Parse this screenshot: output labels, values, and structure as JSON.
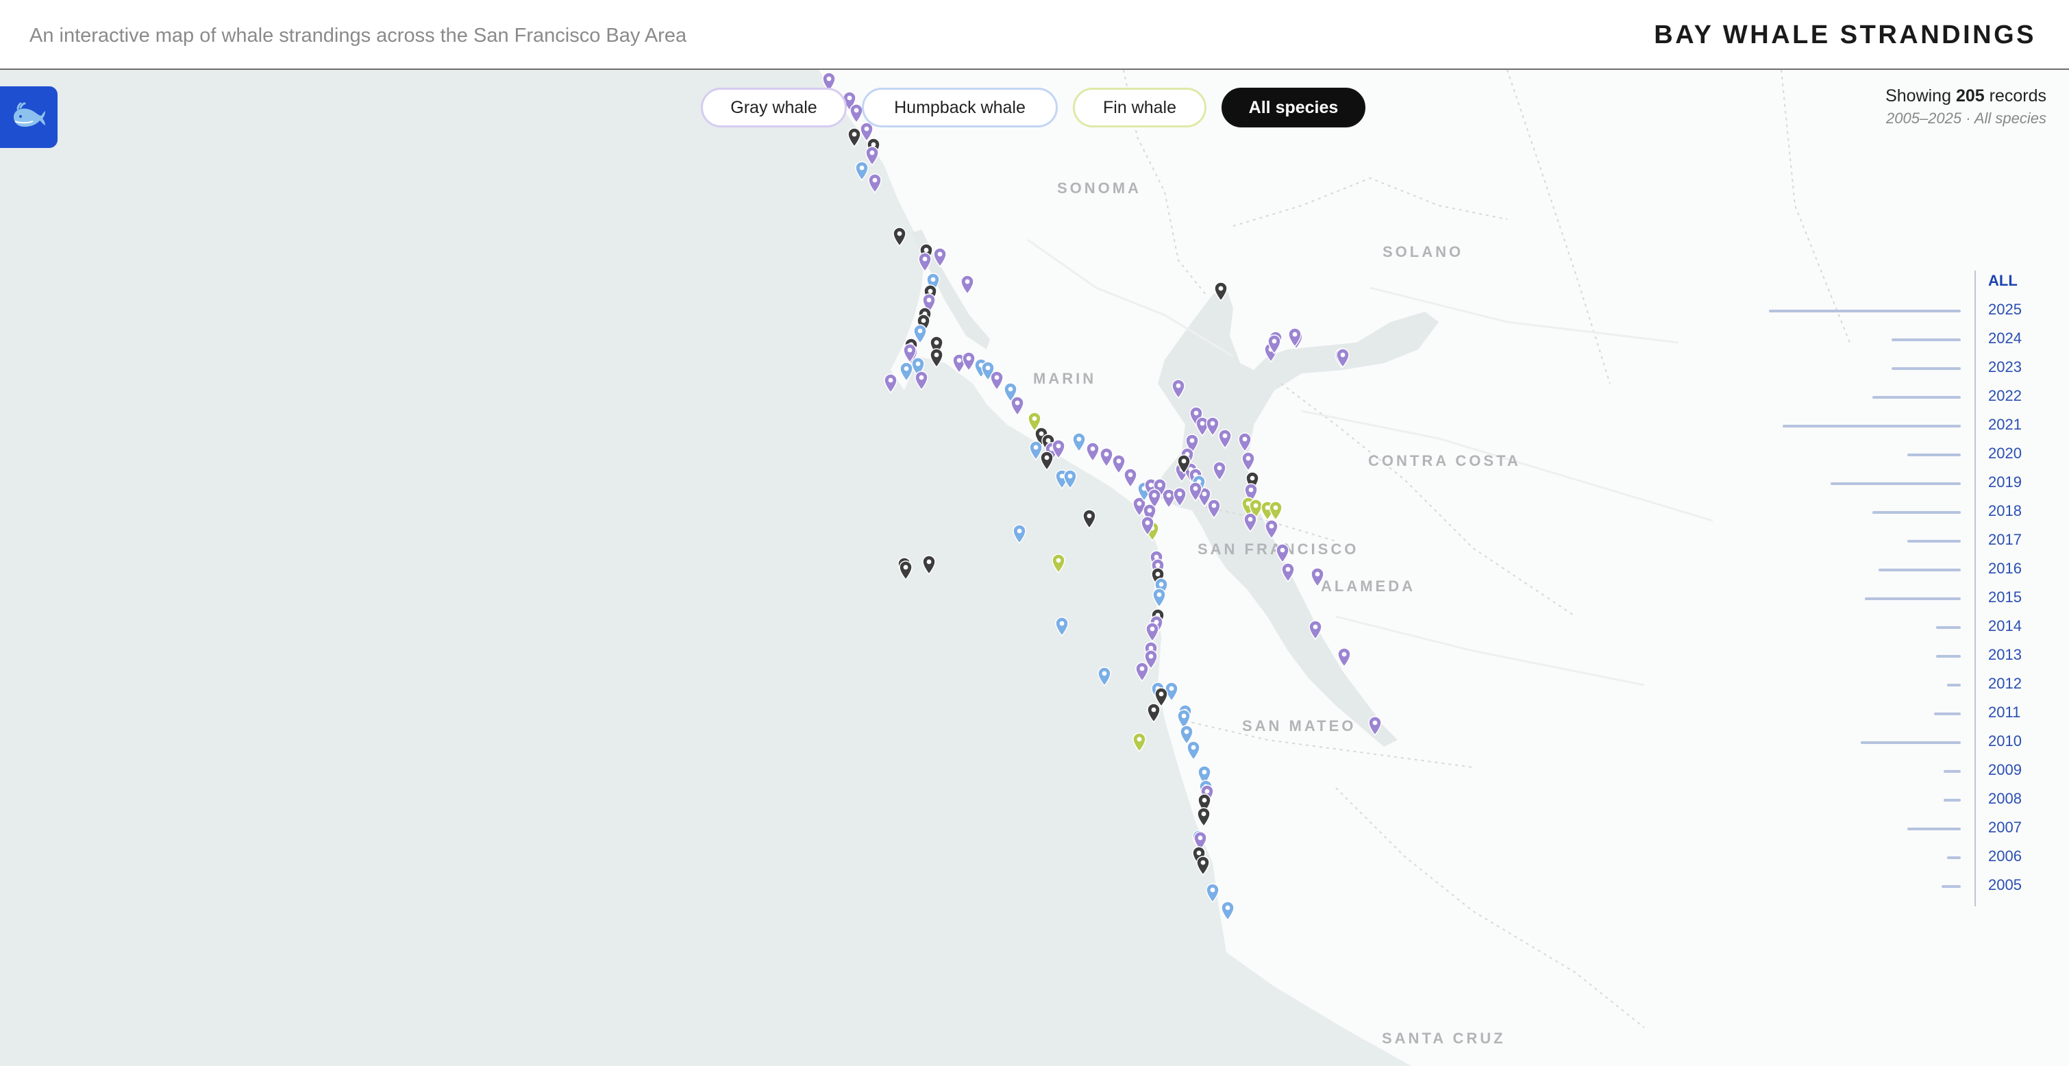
{
  "header": {
    "subtitle": "An interactive map of whale strandings across the San Francisco Bay Area",
    "title": "BAY WHALE STRANDINGS"
  },
  "filters": [
    {
      "label": "Gray whale",
      "active": false,
      "color": "#9b84d1"
    },
    {
      "label": "Humpback whale",
      "active": false,
      "color": "#7aaee6"
    },
    {
      "label": "Fin whale",
      "active": false,
      "color": "#b5c94a"
    },
    {
      "label": "All species",
      "active": true,
      "color": "#0f0f0f"
    }
  ],
  "records": {
    "prefix": "Showing",
    "count": "205",
    "suffix": "records",
    "range": "2005–2025 · All species"
  },
  "years": [
    {
      "label": "ALL",
      "value": null,
      "active": true
    },
    {
      "label": "2025",
      "value": 1.0
    },
    {
      "label": "2024",
      "value": 0.36
    },
    {
      "label": "2023",
      "value": 0.36
    },
    {
      "label": "2022",
      "value": 0.46
    },
    {
      "label": "2021",
      "value": 0.93
    },
    {
      "label": "2020",
      "value": 0.28
    },
    {
      "label": "2019",
      "value": 0.68
    },
    {
      "label": "2018",
      "value": 0.46
    },
    {
      "label": "2017",
      "value": 0.28
    },
    {
      "label": "2016",
      "value": 0.43
    },
    {
      "label": "2015",
      "value": 0.5
    },
    {
      "label": "2014",
      "value": 0.13
    },
    {
      "label": "2013",
      "value": 0.13
    },
    {
      "label": "2012",
      "value": 0.07
    },
    {
      "label": "2011",
      "value": 0.14
    },
    {
      "label": "2010",
      "value": 0.52
    },
    {
      "label": "2009",
      "value": 0.09
    },
    {
      "label": "2008",
      "value": 0.09
    },
    {
      "label": "2007",
      "value": 0.28
    },
    {
      "label": "2006",
      "value": 0.07
    },
    {
      "label": "2005",
      "value": 0.1
    }
  ],
  "regions": [
    "SONOMA",
    "SOLANO",
    "MARIN",
    "CONTRA COSTA",
    "SAN FRANCISCO",
    "ALAMEDA",
    "SAN MATEO",
    "SANTA CRUZ"
  ],
  "species_colors": {
    "gray": "#9b84d1",
    "humpback": "#7aaee6",
    "fin": "#b5c94a",
    "other": "#3d3d3d"
  },
  "icons": {
    "app": "whale-icon",
    "marker": "map-pin-icon"
  }
}
